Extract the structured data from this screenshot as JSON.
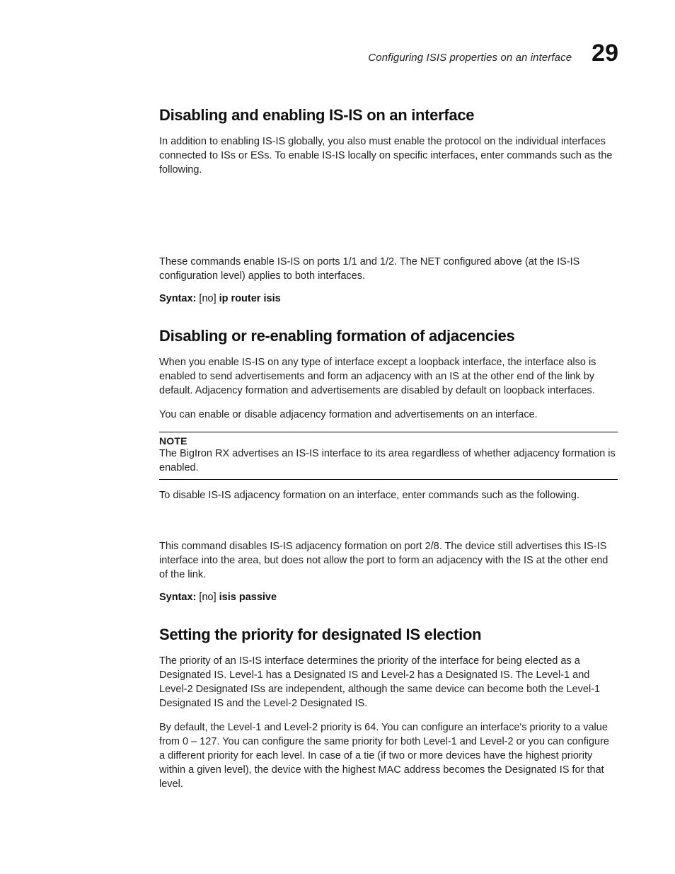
{
  "header": {
    "running_title": "Configuring ISIS properties on an interface",
    "chapter_number": "29"
  },
  "sections": [
    {
      "title": "Disabling and enabling IS-IS on an interface",
      "paras": [
        "In addition to enabling IS-IS globally, you also must enable the protocol on the individual interfaces connected to ISs or ESs. To enable IS-IS locally on specific interfaces, enter commands such as the following."
      ],
      "gap_after_first": true,
      "gap_size": "large",
      "paras_after": [
        "These commands enable IS-IS on ports 1/1 and 1/2. The NET configured above (at the IS-IS configuration level) applies to both interfaces."
      ],
      "syntax": {
        "label": "Syntax:",
        "text_nonbold": " [no] ",
        "text_bold": "ip router isis"
      }
    },
    {
      "title": "Disabling or re-enabling formation of adjacencies",
      "paras": [
        "When you enable IS-IS on any type of interface except a loopback interface, the interface also is enabled to send advertisements and form an adjacency with an IS at the other end of the link by default. Adjacency formation and advertisements are disabled by default on loopback interfaces.",
        "You can enable or disable adjacency formation and advertisements on an interface."
      ],
      "note": {
        "label": "NOTE",
        "text": "The BigIron RX advertises an IS-IS interface to its area regardless of whether adjacency formation is enabled."
      },
      "paras_after_note": [
        "To disable IS-IS adjacency formation on an interface, enter commands such as the following."
      ],
      "gap_size": "small",
      "paras_after": [
        "This command disables IS-IS adjacency formation on port 2/8. The device still advertises this IS-IS interface into the area, but does not allow the port to form an adjacency with the IS at the other end of the link."
      ],
      "syntax": {
        "label": "Syntax:",
        "text_nonbold": " [no] ",
        "text_bold": "isis passive"
      }
    },
    {
      "title": "Setting the priority for designated IS election",
      "paras": [
        "The priority of an IS-IS interface determines the priority of the interface for being elected as a Designated IS. Level-1 has a Designated IS and Level-2 has a Designated IS. The Level-1 and Level-2 Designated ISs are independent, although the same device can become both the Level-1 Designated IS and the Level-2 Designated IS.",
        "By default, the Level-1 and Level-2 priority is 64. You can configure an interface's priority to a value from 0 – 127. You can configure the same priority for both Level-1 and Level-2 or you can configure a different priority for each level. In case of a tie (if two or more devices have the highest priority within a given level), the device with the highest MAC address becomes the Designated IS for that level."
      ]
    }
  ]
}
